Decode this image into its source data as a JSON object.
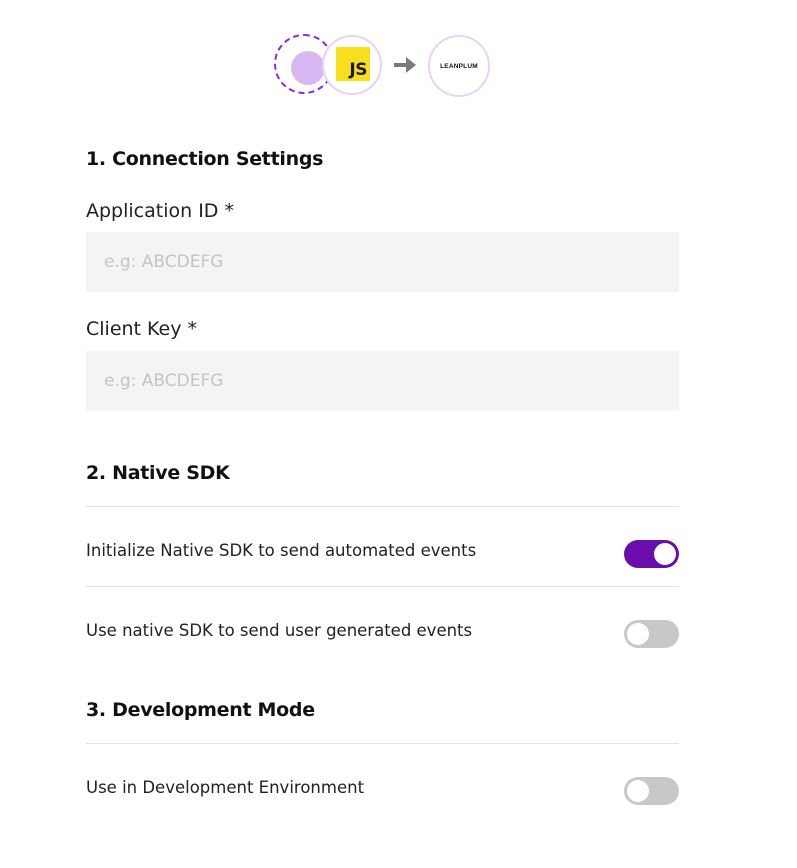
{
  "header": {
    "source_icon": "source-placeholder-icon",
    "source_badge_text": "JS",
    "arrow_icon": "arrow-right-icon",
    "destination_logo_text": "LEANPLUM"
  },
  "sections": {
    "connection": {
      "title": "1. Connection Settings",
      "application_id": {
        "label": "Application ID *",
        "value": "",
        "placeholder": "e.g: ABCDEFG"
      },
      "client_key": {
        "label": "Client Key *",
        "value": "",
        "placeholder": "e.g: ABCDEFG"
      }
    },
    "native_sdk": {
      "title": "2. Native SDK",
      "initialize": {
        "label": "Initialize Native SDK to send automated events",
        "enabled": true
      },
      "user_events": {
        "label": "Use native SDK to send user generated events",
        "enabled": false
      }
    },
    "development": {
      "title": "3. Development Mode",
      "dev_env": {
        "label": "Use in Development Environment",
        "enabled": false
      }
    }
  },
  "colors": {
    "accent": "#6a0dad",
    "toggle_off": "#c8c8c8",
    "js_yellow": "#f7df1e",
    "circle_border": "#e7d3f7",
    "dashed_border": "#8a2be2",
    "input_bg": "#f4f4f4"
  }
}
